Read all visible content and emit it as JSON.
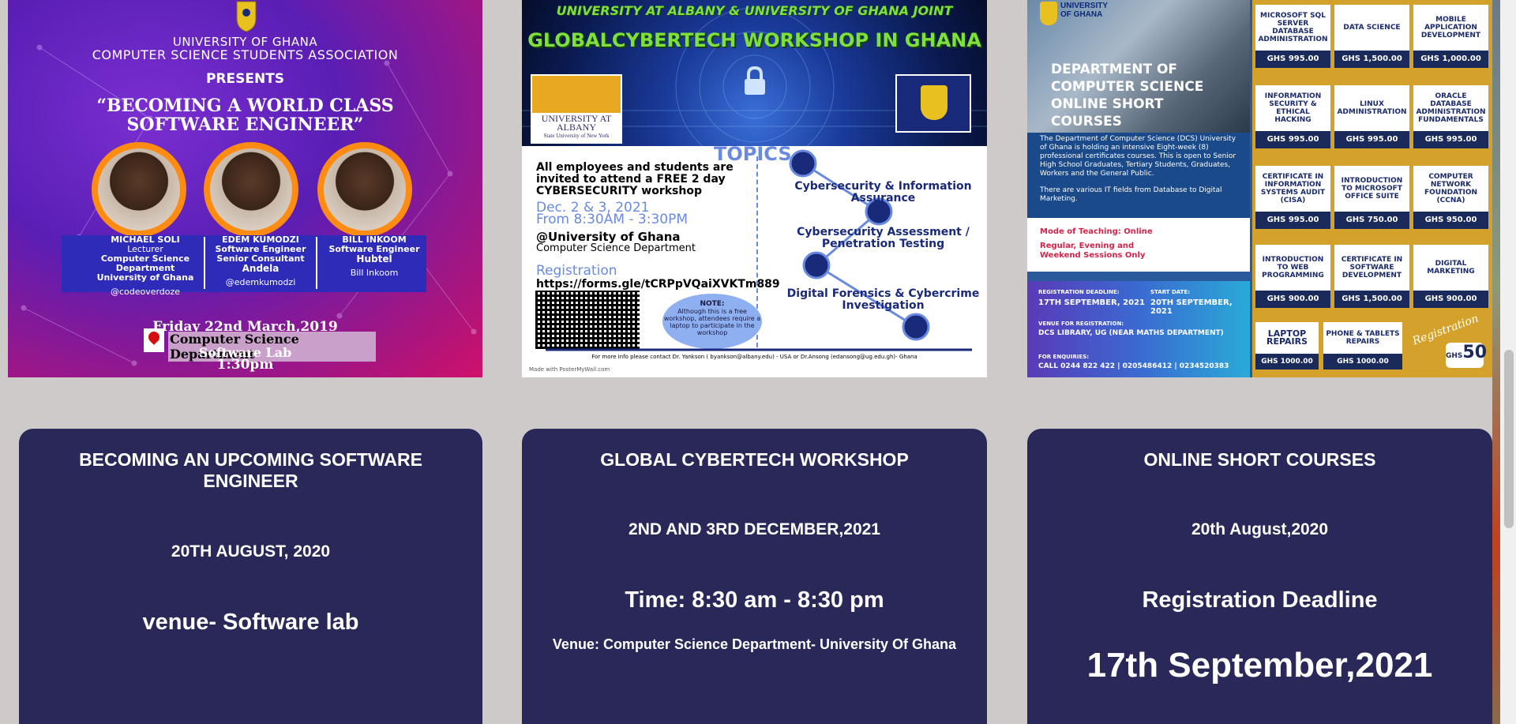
{
  "poster1": {
    "university": "UNIVERSITY OF GHANA",
    "association": "COMPUTER SCIENCE STUDENTS ASSOCIATION",
    "presents": "PRESENTS",
    "title": "“BECOMING A WORLD CLASS SOFTWARE ENGINEER”",
    "speakers": [
      {
        "name": "MICHAEL SOLI",
        "role": "Lecturer",
        "dept": "Computer Science Department",
        "org": "University of Ghana",
        "handle": "@codeoverdoze"
      },
      {
        "name": "EDEM KUMODZI",
        "role": "Software Engineer",
        "dept": "Senior Consultant",
        "org": "Andela",
        "handle": "@edemkumodzi"
      },
      {
        "name": "BILL INKOOM",
        "role": "Software Engineer",
        "dept": "",
        "org": "Hubtel",
        "handle": "Bill Inkoom"
      }
    ],
    "date": "Friday 22nd March,2019",
    "location": "Computer Science Department",
    "lab": "Software Lab",
    "time": "1:30pm"
  },
  "poster2": {
    "heading1": "UNIVERSITY AT ALBANY & UNIVERSITY OF GHANA JOINT",
    "heading2": "GLOBALCYBERTECH WORKSHOP IN GHANA",
    "albany": "UNIVERSITY AT ALBANY",
    "albany_sub": "State University of New York",
    "topics_label": "TOPICS",
    "invite": "All employees and students are invited to attend a FREE 2 day CYBERSECURITY workshop",
    "dates": "Dec. 2 & 3, 2021",
    "hours": "From 8:30AM - 3:30PM",
    "venue": "@University of Ghana",
    "dept": "Computer Science Department",
    "registration": "Registration",
    "link": "https://forms.gle/tCRPpVQaiXVKTm889",
    "note_title": "NOTE:",
    "note": "Although this is a free workshop, attendees require a laptop to participate in the workshop",
    "topics": [
      "Cybersecurity & Information Assurance",
      "Cybersecurity Assessment / Penetration Testing",
      "Digital Forensics & Cybercrime Investigation"
    ],
    "footer": "For more info please contact Dr. Yankson ( byankson@albany.edu) - USA   or Dr.Ansong (edansong@ug.edu.gh)- Ghana",
    "made_with": "Made with PosterMyWall.com"
  },
  "poster3": {
    "university": "UNIVERSITY OF GHANA",
    "department_title": "DEPARTMENT OF COMPUTER SCIENCE ONLINE SHORT COURSES",
    "description": "The Department of Computer Science (DCS) University of Ghana is holding an intensive Eight-week (8) professional certificates courses. This is open to Senior High School Graduates, Tertiary Students, Graduates, Workers and the General Public.",
    "description2": "There are various IT fields from Database to Digital Marketing.",
    "mode_label": "Mode of Teaching:",
    "mode_value": "Online",
    "sessions": "Regular, Evening and Weekend Sessions Only",
    "reg_deadline_label": "REGISTRATION DEADLINE:",
    "reg_deadline": "17TH SEPTEMBER, 2021",
    "start_label": "START DATE:",
    "start_date": "20TH SEPTEMBER, 2021",
    "venue_label": "VENUE FOR REGISTRATION:",
    "venue": "DCS LIBRARY, UG (NEAR MATHS DEPARTMENT)",
    "enquiries_label": "FOR ENQUIRIES:",
    "enquiries": "CALL 0244 822 422 | 0205486412 | 0234520383",
    "courses": [
      {
        "name": "MICROSOFT SQL SERVER DATABASE ADMINISTRATION",
        "price": "GHS 995.00"
      },
      {
        "name": "DATA SCIENCE",
        "price": "GHS 1,500.00"
      },
      {
        "name": "MOBILE APPLICATION DEVELOPMENT",
        "price": "GHS 1,000.00"
      },
      {
        "name": "INFORMATION SECURITY & ETHICAL HACKING",
        "price": "GHS 995.00"
      },
      {
        "name": "LINUX ADMINISTRATION",
        "price": "GHS 995.00"
      },
      {
        "name": "ORACLE DATABASE ADMINISTRATION FUNDAMENTALS",
        "price": "GHS 995.00"
      },
      {
        "name": "CERTIFICATE IN INFORMATION SYSTEMS AUDIT (CISA)",
        "price": "GHS 995.00"
      },
      {
        "name": "INTRODUCTION TO MICROSOFT OFFICE SUITE",
        "price": "GHS 750.00"
      },
      {
        "name": "COMPUTER NETWORK FOUNDATION (CCNA)",
        "price": "GHS 950.00"
      },
      {
        "name": "INTRODUCTION TO WEB PROGRAMMING",
        "price": "GHS 900.00"
      },
      {
        "name": "CERTIFICATE IN SOFTWARE DEVELOPMENT",
        "price": "GHS 1,500.00"
      },
      {
        "name": "DIGITAL MARKETING",
        "price": "GHS 900.00"
      },
      {
        "name": "LAPTOP REPAIRS",
        "price": "GHS 1000.00"
      },
      {
        "name": "PHONE & TABLETS REPAIRS",
        "price": "GHS 1000.00"
      }
    ],
    "registration_script": "Registration",
    "reg_fee_prefix": "GHS",
    "reg_fee": "50"
  },
  "cards": [
    {
      "title": "BECOMING AN UPCOMING SOFTWARE ENGINEER",
      "date": "20TH AUGUST, 2020",
      "venue": "venue- Software lab"
    },
    {
      "title": "GLOBAL CYBERTECH WORKSHOP",
      "date": "2ND AND 3RD DECEMBER,2021",
      "time": "Time: 8:30 am - 8:30 pm",
      "venue": "Venue: Computer Science Department- University Of Ghana"
    },
    {
      "title": "ONLINE SHORT COURSES",
      "date": "20th August,2020",
      "label": "Registration Deadline",
      "deadline": "17th September,2021"
    }
  ],
  "colors": {
    "page_bg": "#cfcaca",
    "card_bg": "#292858",
    "cyber_green": "#7ee03a",
    "speaker_orange": "#ff8c12",
    "courses_gold": "#d4a22a"
  }
}
